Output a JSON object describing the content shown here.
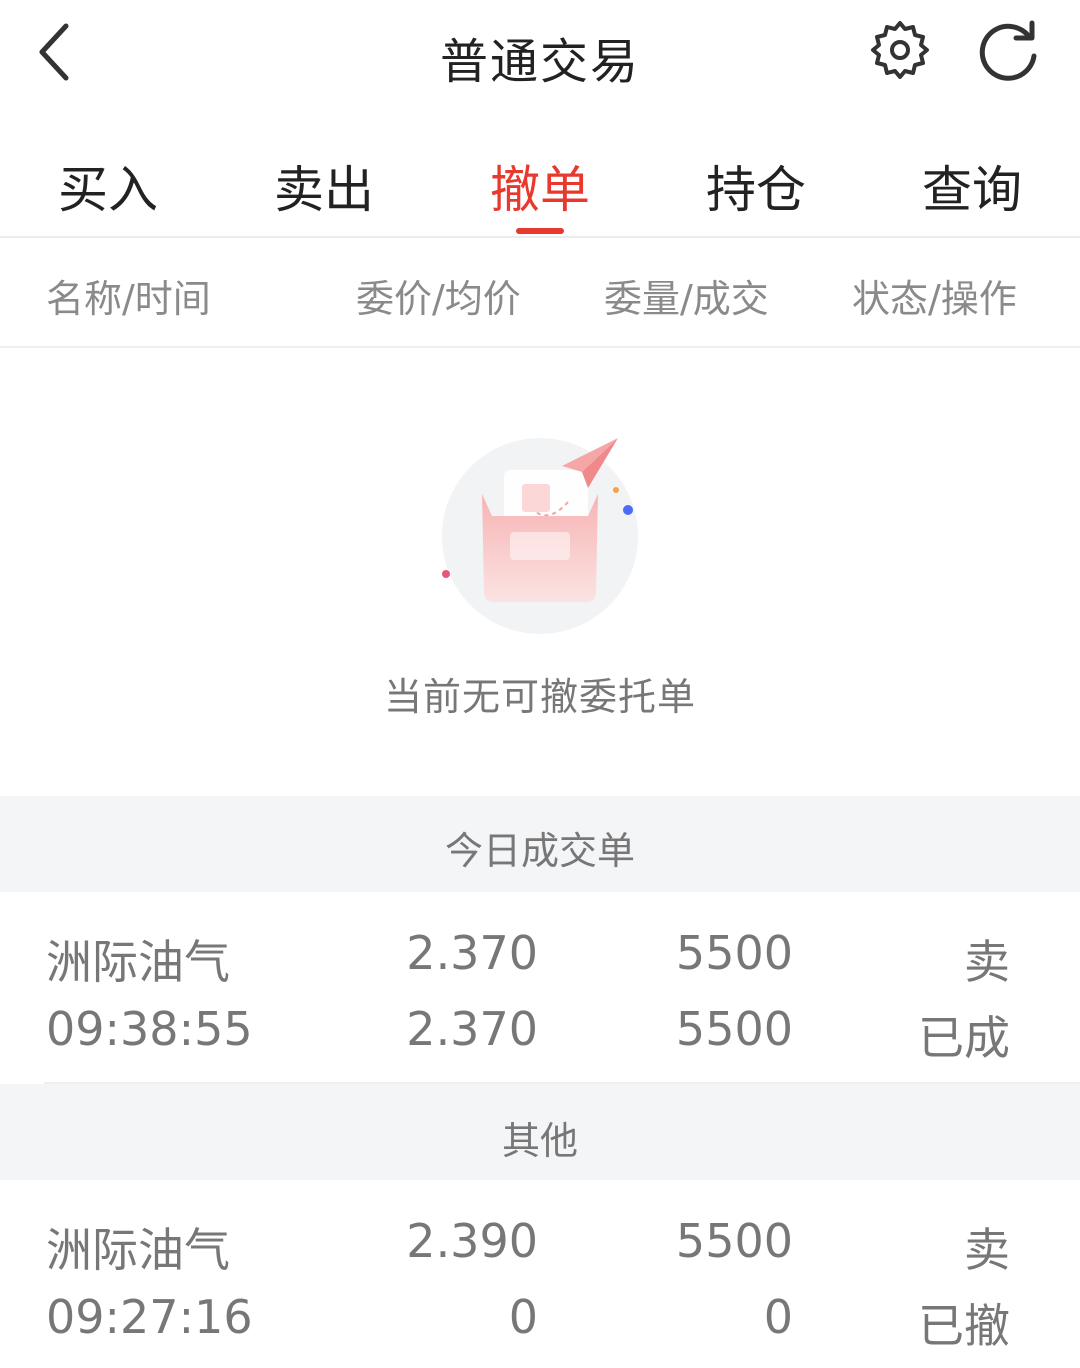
{
  "nav": {
    "title": "普通交易",
    "back_icon": "chevron-left-icon",
    "settings_icon": "gear-icon",
    "refresh_icon": "refresh-icon"
  },
  "tabs": [
    {
      "label": "买入",
      "active": false
    },
    {
      "label": "卖出",
      "active": false
    },
    {
      "label": "撤单",
      "active": true
    },
    {
      "label": "持仓",
      "active": false
    },
    {
      "label": "查询",
      "active": false
    }
  ],
  "columns": {
    "name_time": "名称/时间",
    "price_avg": "委价/均价",
    "qty_filled": "委量/成交",
    "status_action": "状态/操作"
  },
  "empty_state": {
    "text": "当前无可撤委托单",
    "icon": "empty-box-illustration"
  },
  "sections": {
    "today": {
      "title": "今日成交单",
      "rows": [
        {
          "name": "洲际油气",
          "time": "09:38:55",
          "price": "2.370",
          "avg_price": "2.370",
          "quantity": "5500",
          "filled": "5500",
          "direction": "卖",
          "state": "已成"
        }
      ]
    },
    "other": {
      "title": "其他",
      "rows": [
        {
          "name": "洲际油气",
          "time": "09:27:16",
          "price": "2.390",
          "avg_price": "0",
          "quantity": "5500",
          "filled": "0",
          "direction": "卖",
          "state": "已撤"
        }
      ]
    }
  },
  "colors": {
    "accent": "#e8392f",
    "text_primary": "#222222",
    "text_secondary": "#777777",
    "section_bg": "#f4f5f7"
  }
}
